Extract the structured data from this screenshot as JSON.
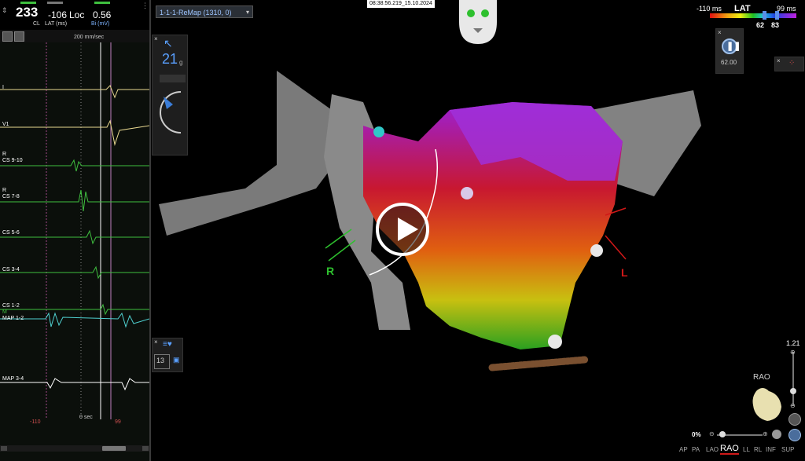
{
  "ecg_panel": {
    "cl_value": "233",
    "cl_label": "CL",
    "lat_value": "-106",
    "lat_label": "LAT (ms)",
    "loc_label": "Loc",
    "bi_value": "0.56",
    "bi_label": "Bi (mV)",
    "sweep_speed": "200 mm/sec",
    "leads": [
      {
        "name": "I",
        "prefix": ""
      },
      {
        "name": "V1",
        "prefix": ""
      },
      {
        "name": "CS 9-10",
        "prefix": "R"
      },
      {
        "name": "CS 7-8",
        "prefix": "R"
      },
      {
        "name": "CS 5-6",
        "prefix": ""
      },
      {
        "name": "CS 3-4",
        "prefix": ""
      },
      {
        "name": "CS 1-2",
        "prefix": ""
      },
      {
        "name": "MAP 1-2",
        "prefix": "M"
      },
      {
        "name": "MAP 3-4",
        "prefix": ""
      }
    ],
    "window_start": "-110",
    "window_zero": "0 sec",
    "window_end": "99"
  },
  "map_select": {
    "value": "1-1-1-ReMap (1310, 0)"
  },
  "timestamp": "08:38:56.219_15.10.2024",
  "left_palette": {
    "close": "×",
    "count": "21",
    "unit": "g",
    "tag_count": "13"
  },
  "lat_scale": {
    "min": "-110 ms",
    "label": "LAT",
    "max": "99 ms",
    "marker_a": "62",
    "marker_b": "83"
  },
  "pause_panel": {
    "close": "×",
    "value": "62.00"
  },
  "orientation_labels": {
    "right": "R",
    "left": "L"
  },
  "zoom": {
    "value": "1.21",
    "percent": "0%"
  },
  "view": {
    "current": "RAO",
    "buttons": [
      "AP",
      "PA",
      "LAO",
      "RAO",
      "LL",
      "RL",
      "INF",
      "SUP"
    ]
  },
  "colors": {
    "ecg_green": "#3fbf3f",
    "ecg_yellow": "#e8d890",
    "ecg_cyan": "#4fd0d0",
    "right_marker": "#2ec02e",
    "left_marker": "#d01818"
  }
}
